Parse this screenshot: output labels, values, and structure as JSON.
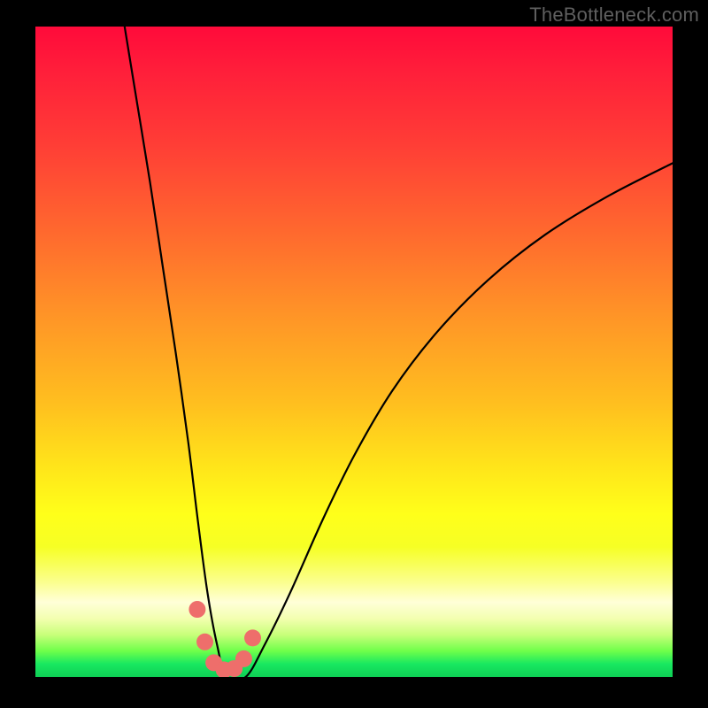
{
  "watermark": "TheBottleneck.com",
  "chart_data": {
    "type": "line",
    "title": "",
    "xlabel": "",
    "ylabel": "",
    "xlim": [
      0,
      100
    ],
    "ylim": [
      0,
      100
    ],
    "series": [
      {
        "name": "bottleneck-curve",
        "x": [
          14,
          16,
          18,
          20,
          22,
          24,
          25.5,
          27,
          28.5,
          30,
          33,
          36,
          40,
          45,
          50,
          56,
          63,
          71,
          80,
          90,
          100
        ],
        "y": [
          100,
          88,
          76,
          63,
          50,
          36,
          24,
          13,
          5,
          0,
          0,
          5,
          13,
          24,
          34,
          44,
          53,
          61,
          68,
          74,
          79
        ]
      }
    ],
    "markers": {
      "name": "highlight-dots",
      "color": "#ee6e6b",
      "x": [
        25.4,
        26.6,
        28.0,
        29.6,
        31.2,
        32.7,
        34.1
      ],
      "y": [
        10.4,
        5.4,
        2.2,
        1.1,
        1.3,
        2.8,
        6.0
      ]
    },
    "background_gradient": {
      "top_color": "#ff0a3a",
      "mid_color": "#ffff1a",
      "bottom_color": "#0ecf55"
    }
  }
}
